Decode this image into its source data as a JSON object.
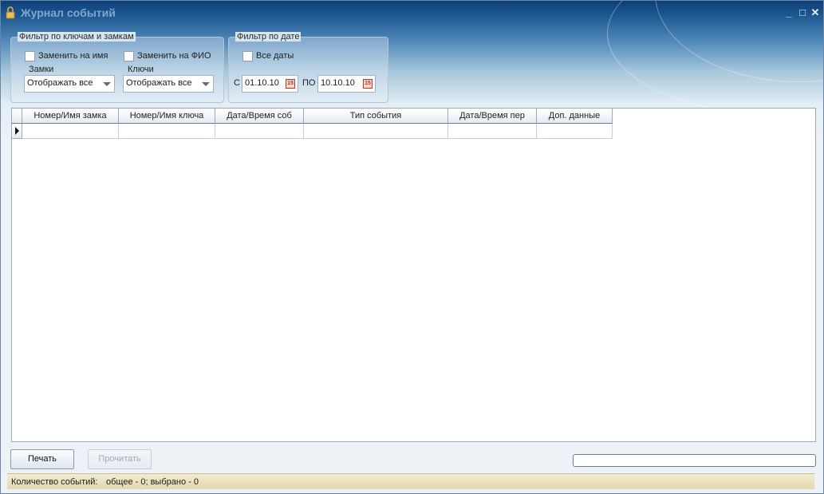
{
  "window": {
    "title": "Журнал событий",
    "controls": {
      "minimize": "_",
      "maximize": "□",
      "close": "✕"
    }
  },
  "filter_keys_locks": {
    "legend": "Фильтр по ключам и замкам",
    "replace_name_label": "Заменить на имя",
    "replace_name_checked": false,
    "replace_fio_label": "Заменить на ФИО",
    "replace_fio_checked": false,
    "locks_label": "Замки",
    "locks_value": "Отображать все",
    "keys_label": "Ключи",
    "keys_value": "Отображать все"
  },
  "filter_date": {
    "legend": "Фильтр по дате",
    "all_dates_label": "Все даты",
    "all_dates_checked": false,
    "from_label": "С",
    "from_value": "01.10.10",
    "to_label": "ПО",
    "to_value": "10.10.10",
    "calendar_glyph": "15"
  },
  "table": {
    "columns": [
      "Номер/Имя замка",
      "Номер/Имя ключа",
      "Дата/Время соб",
      "Тип события",
      "Дата/Время пер",
      "Доп. данные"
    ],
    "rows": [
      [
        "",
        "",
        "",
        "",
        "",
        ""
      ]
    ]
  },
  "buttons": {
    "print": "Печать",
    "read": "Прочитать"
  },
  "status": {
    "count_label": "Количество событий:",
    "summary": "общее - 0;  выбрано - 0"
  },
  "icons": [
    "lock-icon",
    "calendar-icon",
    "row-pointer-icon",
    "dropdown-arrow-icon"
  ]
}
